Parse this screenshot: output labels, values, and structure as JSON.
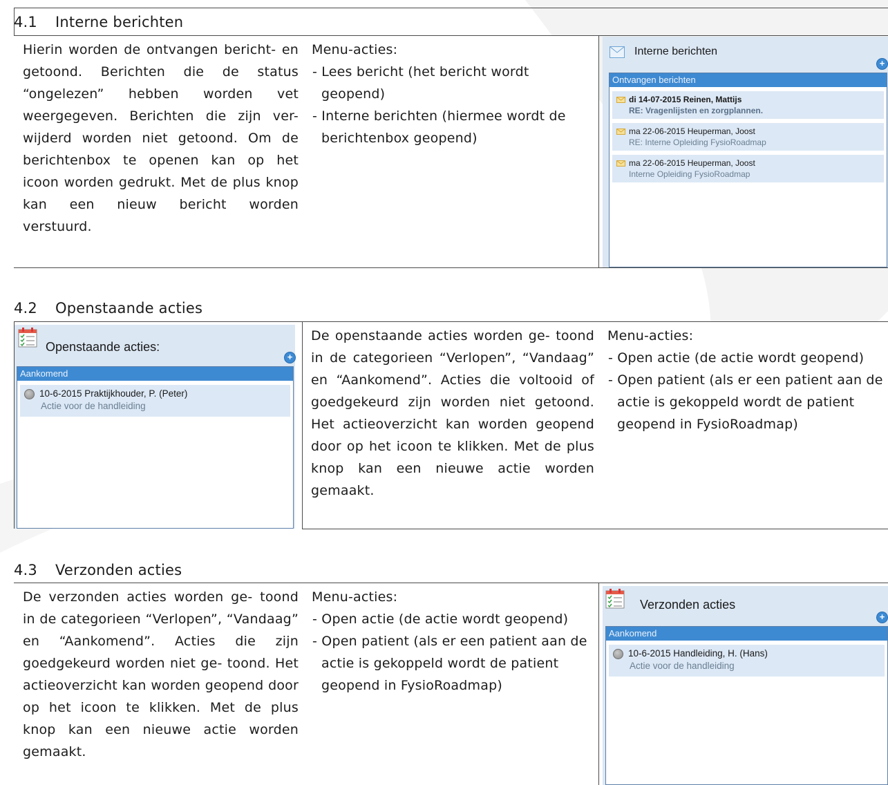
{
  "sections": [
    {
      "number": "4.1",
      "title": "Interne berichten",
      "description": "Hierin worden de ontvangen bericht- en getoond. Berichten die de status “ongelezen” hebben worden vet weergegeven. Berichten die zijn ver- wijderd worden niet getoond. Om de berichtenbox te openen kan op het icoon worden gedrukt. Met de plus knop kan een nieuw bericht worden verstuurd.",
      "menu_heading": "Menu-acties:",
      "menu_items": [
        "- Lees bericht (het bericht wordt geopend)",
        "- Interne berichten (hiermee wordt de berichtenbox geopend)"
      ],
      "widget": {
        "title": "Interne berichten",
        "icon": "envelope-icon",
        "bar_label": "Ontvangen berichten",
        "items": [
          {
            "line1": "di 14-07-2015  Reinen, Mattijs",
            "line2": "RE: Vragenlijsten en zorgplannen.",
            "bold": true
          },
          {
            "line1": "ma 22-06-2015  Heuperman, Joost",
            "line2": "RE: Interne Opleiding FysioRoadmap",
            "bold": false
          },
          {
            "line1": "ma 22-06-2015  Heuperman, Joost",
            "line2": "Interne Opleiding FysioRoadmap",
            "bold": false
          }
        ]
      }
    },
    {
      "number": "4.2",
      "title": "Openstaande acties",
      "description": "De openstaande acties worden ge- toond in de categorieen “Verlopen”, “Vandaag” en “Aankomend”. Acties die voltooid of goedgekeurd zijn worden niet getoond. Het actieoverzicht kan worden geopend door op het icoon te klikken. Met de plus knop kan een nieuwe actie worden gemaakt.",
      "menu_heading": "Menu-acties:",
      "menu_items": [
        "- Open actie (de actie wordt geopend)",
        "- Open patient (als er een patient aan de actie is gekoppeld wordt de patient geopend in FysioRoadmap)"
      ],
      "widget": {
        "title": "Openstaande acties:",
        "icon": "calendar-checklist-icon",
        "bar_label": "Aankomend",
        "items": [
          {
            "line1": "10-6-2015  Praktijkhouder, P.  (Peter)",
            "line2": "Actie voor de handleiding"
          }
        ]
      }
    },
    {
      "number": "4.3",
      "title": "Verzonden acties",
      "description": "De verzonden acties worden ge- toond in de categorieen “Verlopen”, “Vandaag” en “Aankomend”. Acties die zijn goedgekeurd worden niet ge- toond. Het actieoverzicht kan worden geopend door op het icoon te klikken. Met de plus knop kan een nieuwe actie worden gemaakt.",
      "menu_heading": "Menu-acties:",
      "menu_items": [
        "- Open actie (de actie wordt geopend)",
        "- Open patient (als er een patient aan de actie is gekoppeld wordt de patient geopend in FysioRoadmap)"
      ],
      "widget": {
        "title": "Verzonden acties",
        "icon": "calendar-checklist-icon",
        "bar_label": "Aankomend",
        "items": [
          {
            "line1": "10-6-2015  Handleiding, H.  (Hans)",
            "line2": "Actie voor de handleiding"
          }
        ]
      }
    }
  ],
  "colors": {
    "widget_background": "#dbe7f3",
    "widget_bar": "#3e8ad2",
    "item_background": "#dce8f5",
    "plus_button": "#3d8bd4"
  }
}
